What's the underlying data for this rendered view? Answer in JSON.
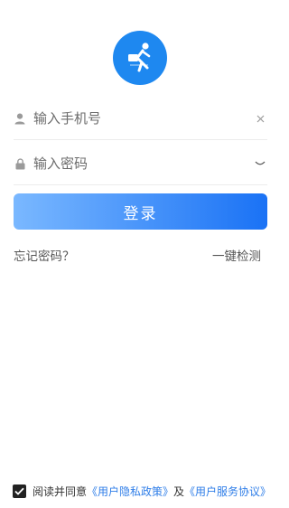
{
  "logo": {
    "icon": "running-courier-icon",
    "color": "#1e88f0"
  },
  "phone_field": {
    "placeholder": "输入手机号",
    "value": "",
    "leading_icon": "user-icon",
    "trailing_icon": "clear-icon"
  },
  "password_field": {
    "placeholder": "输入密码",
    "value": "",
    "leading_icon": "lock-icon",
    "trailing_icon": "eye-closed-icon"
  },
  "login_button": {
    "label": "登录",
    "gradient": [
      "#7ab8ff",
      "#1a72f5"
    ]
  },
  "links": {
    "forgot": "忘记密码？",
    "detect": "一键检测"
  },
  "agreement": {
    "checked": true,
    "prefix": "阅读并同意",
    "privacy": "《用户隐私政策》",
    "joiner": "及",
    "service": "《用户服务协议》",
    "link_color": "#2f7ee8"
  }
}
